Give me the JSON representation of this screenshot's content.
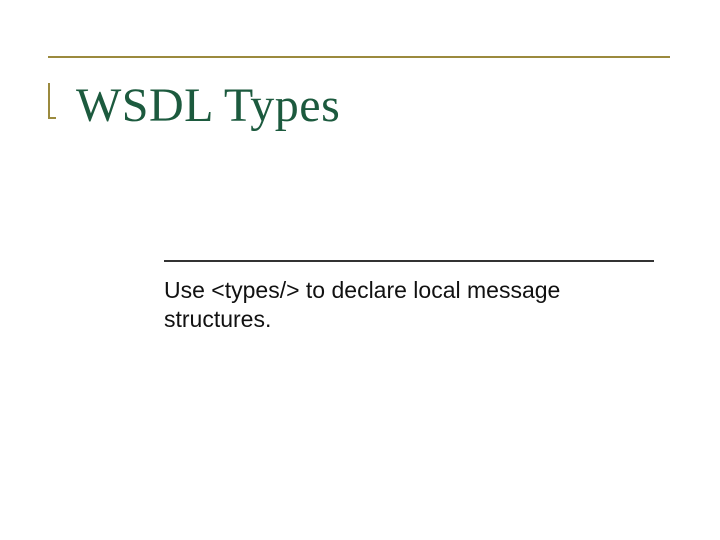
{
  "slide": {
    "title": "WSDL Types",
    "subtitle": "Use <types/> to declare local message structures."
  },
  "colors": {
    "title_color": "#1c5a3e",
    "accent_rule": "#9b8a3e",
    "sub_rule": "#333333",
    "body_text": "#111111"
  }
}
